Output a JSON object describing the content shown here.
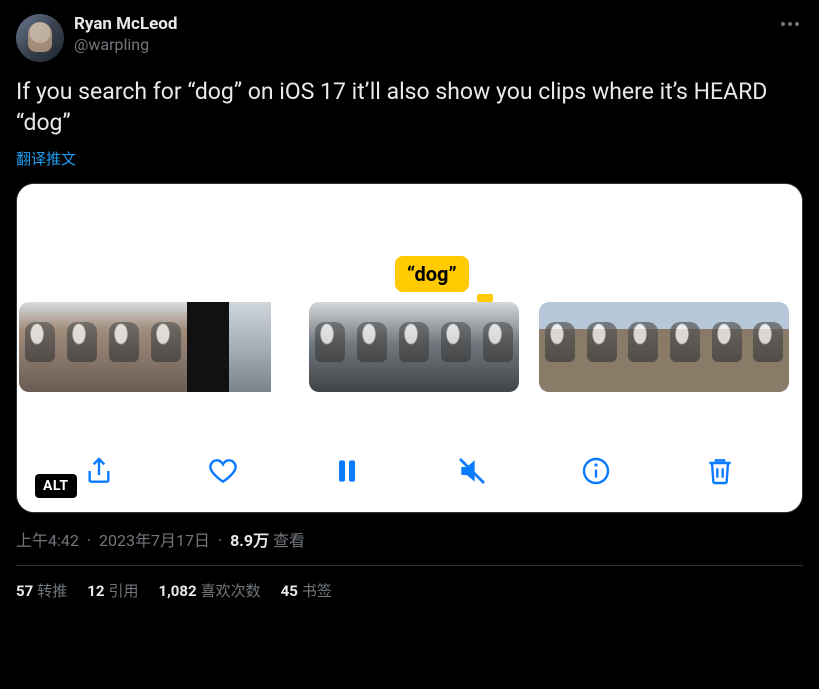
{
  "author": {
    "display_name": "Ryan McLeod",
    "handle": "@warpling"
  },
  "tweet_text": "If you search for “dog” on iOS 17 it’ll also show you clips where it’s HEARD “dog”",
  "translate_label": "翻译推文",
  "media": {
    "caption_bubble": "“dog”",
    "alt_badge": "ALT",
    "toolbar_icons": {
      "share": "share-icon",
      "like": "heart-icon",
      "pause": "pause-icon",
      "mute": "mute-icon",
      "info": "info-icon",
      "trash": "trash-icon"
    }
  },
  "meta": {
    "time": "上午4:42",
    "date": "2023年7月17日",
    "views_count": "8.9万",
    "views_label": "查看"
  },
  "stats": {
    "retweets": {
      "count": "57",
      "label": "转推"
    },
    "quotes": {
      "count": "12",
      "label": "引用"
    },
    "likes": {
      "count": "1,082",
      "label": "喜欢次数"
    },
    "bookmarks": {
      "count": "45",
      "label": "书签"
    }
  },
  "icon_color": "#0a7aff"
}
